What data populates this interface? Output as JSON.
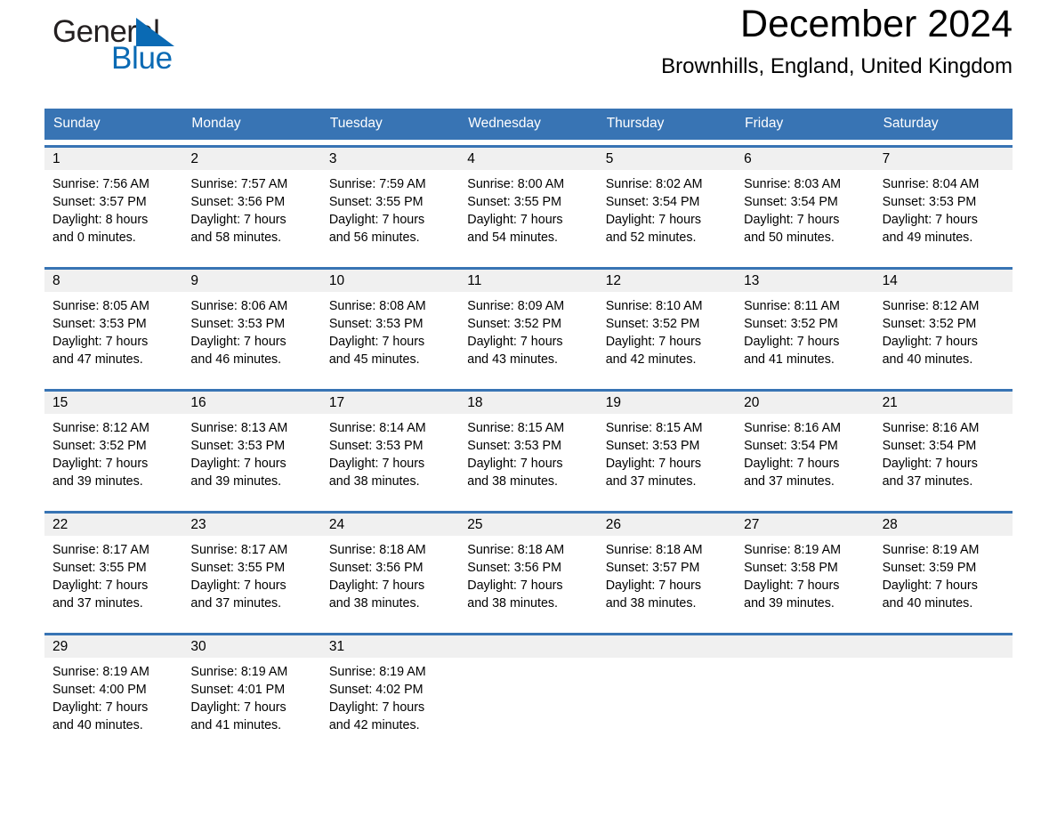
{
  "brand": {
    "name_part1": "General",
    "name_part2": "Blue",
    "triangle_color": "#0a6ab4",
    "text_color": "#231f20"
  },
  "header": {
    "title": "December 2024",
    "subtitle": "Brownhills, England, United Kingdom"
  },
  "theme": {
    "header_blue": "#3874b4",
    "day_band_gray": "#f0f0f0",
    "page_background": "#ffffff"
  },
  "weekdays": [
    "Sunday",
    "Monday",
    "Tuesday",
    "Wednesday",
    "Thursday",
    "Friday",
    "Saturday"
  ],
  "weeks": [
    [
      {
        "day": "1",
        "sunrise": "Sunrise: 7:56 AM",
        "sunset": "Sunset: 3:57 PM",
        "daylight_line1": "Daylight: 8 hours",
        "daylight_line2": "and 0 minutes."
      },
      {
        "day": "2",
        "sunrise": "Sunrise: 7:57 AM",
        "sunset": "Sunset: 3:56 PM",
        "daylight_line1": "Daylight: 7 hours",
        "daylight_line2": "and 58 minutes."
      },
      {
        "day": "3",
        "sunrise": "Sunrise: 7:59 AM",
        "sunset": "Sunset: 3:55 PM",
        "daylight_line1": "Daylight: 7 hours",
        "daylight_line2": "and 56 minutes."
      },
      {
        "day": "4",
        "sunrise": "Sunrise: 8:00 AM",
        "sunset": "Sunset: 3:55 PM",
        "daylight_line1": "Daylight: 7 hours",
        "daylight_line2": "and 54 minutes."
      },
      {
        "day": "5",
        "sunrise": "Sunrise: 8:02 AM",
        "sunset": "Sunset: 3:54 PM",
        "daylight_line1": "Daylight: 7 hours",
        "daylight_line2": "and 52 minutes."
      },
      {
        "day": "6",
        "sunrise": "Sunrise: 8:03 AM",
        "sunset": "Sunset: 3:54 PM",
        "daylight_line1": "Daylight: 7 hours",
        "daylight_line2": "and 50 minutes."
      },
      {
        "day": "7",
        "sunrise": "Sunrise: 8:04 AM",
        "sunset": "Sunset: 3:53 PM",
        "daylight_line1": "Daylight: 7 hours",
        "daylight_line2": "and 49 minutes."
      }
    ],
    [
      {
        "day": "8",
        "sunrise": "Sunrise: 8:05 AM",
        "sunset": "Sunset: 3:53 PM",
        "daylight_line1": "Daylight: 7 hours",
        "daylight_line2": "and 47 minutes."
      },
      {
        "day": "9",
        "sunrise": "Sunrise: 8:06 AM",
        "sunset": "Sunset: 3:53 PM",
        "daylight_line1": "Daylight: 7 hours",
        "daylight_line2": "and 46 minutes."
      },
      {
        "day": "10",
        "sunrise": "Sunrise: 8:08 AM",
        "sunset": "Sunset: 3:53 PM",
        "daylight_line1": "Daylight: 7 hours",
        "daylight_line2": "and 45 minutes."
      },
      {
        "day": "11",
        "sunrise": "Sunrise: 8:09 AM",
        "sunset": "Sunset: 3:52 PM",
        "daylight_line1": "Daylight: 7 hours",
        "daylight_line2": "and 43 minutes."
      },
      {
        "day": "12",
        "sunrise": "Sunrise: 8:10 AM",
        "sunset": "Sunset: 3:52 PM",
        "daylight_line1": "Daylight: 7 hours",
        "daylight_line2": "and 42 minutes."
      },
      {
        "day": "13",
        "sunrise": "Sunrise: 8:11 AM",
        "sunset": "Sunset: 3:52 PM",
        "daylight_line1": "Daylight: 7 hours",
        "daylight_line2": "and 41 minutes."
      },
      {
        "day": "14",
        "sunrise": "Sunrise: 8:12 AM",
        "sunset": "Sunset: 3:52 PM",
        "daylight_line1": "Daylight: 7 hours",
        "daylight_line2": "and 40 minutes."
      }
    ],
    [
      {
        "day": "15",
        "sunrise": "Sunrise: 8:12 AM",
        "sunset": "Sunset: 3:52 PM",
        "daylight_line1": "Daylight: 7 hours",
        "daylight_line2": "and 39 minutes."
      },
      {
        "day": "16",
        "sunrise": "Sunrise: 8:13 AM",
        "sunset": "Sunset: 3:53 PM",
        "daylight_line1": "Daylight: 7 hours",
        "daylight_line2": "and 39 minutes."
      },
      {
        "day": "17",
        "sunrise": "Sunrise: 8:14 AM",
        "sunset": "Sunset: 3:53 PM",
        "daylight_line1": "Daylight: 7 hours",
        "daylight_line2": "and 38 minutes."
      },
      {
        "day": "18",
        "sunrise": "Sunrise: 8:15 AM",
        "sunset": "Sunset: 3:53 PM",
        "daylight_line1": "Daylight: 7 hours",
        "daylight_line2": "and 38 minutes."
      },
      {
        "day": "19",
        "sunrise": "Sunrise: 8:15 AM",
        "sunset": "Sunset: 3:53 PM",
        "daylight_line1": "Daylight: 7 hours",
        "daylight_line2": "and 37 minutes."
      },
      {
        "day": "20",
        "sunrise": "Sunrise: 8:16 AM",
        "sunset": "Sunset: 3:54 PM",
        "daylight_line1": "Daylight: 7 hours",
        "daylight_line2": "and 37 minutes."
      },
      {
        "day": "21",
        "sunrise": "Sunrise: 8:16 AM",
        "sunset": "Sunset: 3:54 PM",
        "daylight_line1": "Daylight: 7 hours",
        "daylight_line2": "and 37 minutes."
      }
    ],
    [
      {
        "day": "22",
        "sunrise": "Sunrise: 8:17 AM",
        "sunset": "Sunset: 3:55 PM",
        "daylight_line1": "Daylight: 7 hours",
        "daylight_line2": "and 37 minutes."
      },
      {
        "day": "23",
        "sunrise": "Sunrise: 8:17 AM",
        "sunset": "Sunset: 3:55 PM",
        "daylight_line1": "Daylight: 7 hours",
        "daylight_line2": "and 37 minutes."
      },
      {
        "day": "24",
        "sunrise": "Sunrise: 8:18 AM",
        "sunset": "Sunset: 3:56 PM",
        "daylight_line1": "Daylight: 7 hours",
        "daylight_line2": "and 38 minutes."
      },
      {
        "day": "25",
        "sunrise": "Sunrise: 8:18 AM",
        "sunset": "Sunset: 3:56 PM",
        "daylight_line1": "Daylight: 7 hours",
        "daylight_line2": "and 38 minutes."
      },
      {
        "day": "26",
        "sunrise": "Sunrise: 8:18 AM",
        "sunset": "Sunset: 3:57 PM",
        "daylight_line1": "Daylight: 7 hours",
        "daylight_line2": "and 38 minutes."
      },
      {
        "day": "27",
        "sunrise": "Sunrise: 8:19 AM",
        "sunset": "Sunset: 3:58 PM",
        "daylight_line1": "Daylight: 7 hours",
        "daylight_line2": "and 39 minutes."
      },
      {
        "day": "28",
        "sunrise": "Sunrise: 8:19 AM",
        "sunset": "Sunset: 3:59 PM",
        "daylight_line1": "Daylight: 7 hours",
        "daylight_line2": "and 40 minutes."
      }
    ],
    [
      {
        "day": "29",
        "sunrise": "Sunrise: 8:19 AM",
        "sunset": "Sunset: 4:00 PM",
        "daylight_line1": "Daylight: 7 hours",
        "daylight_line2": "and 40 minutes."
      },
      {
        "day": "30",
        "sunrise": "Sunrise: 8:19 AM",
        "sunset": "Sunset: 4:01 PM",
        "daylight_line1": "Daylight: 7 hours",
        "daylight_line2": "and 41 minutes."
      },
      {
        "day": "31",
        "sunrise": "Sunrise: 8:19 AM",
        "sunset": "Sunset: 4:02 PM",
        "daylight_line1": "Daylight: 7 hours",
        "daylight_line2": "and 42 minutes."
      },
      {
        "day": "",
        "sunrise": "",
        "sunset": "",
        "daylight_line1": "",
        "daylight_line2": ""
      },
      {
        "day": "",
        "sunrise": "",
        "sunset": "",
        "daylight_line1": "",
        "daylight_line2": ""
      },
      {
        "day": "",
        "sunrise": "",
        "sunset": "",
        "daylight_line1": "",
        "daylight_line2": ""
      },
      {
        "day": "",
        "sunrise": "",
        "sunset": "",
        "daylight_line1": "",
        "daylight_line2": ""
      }
    ]
  ]
}
